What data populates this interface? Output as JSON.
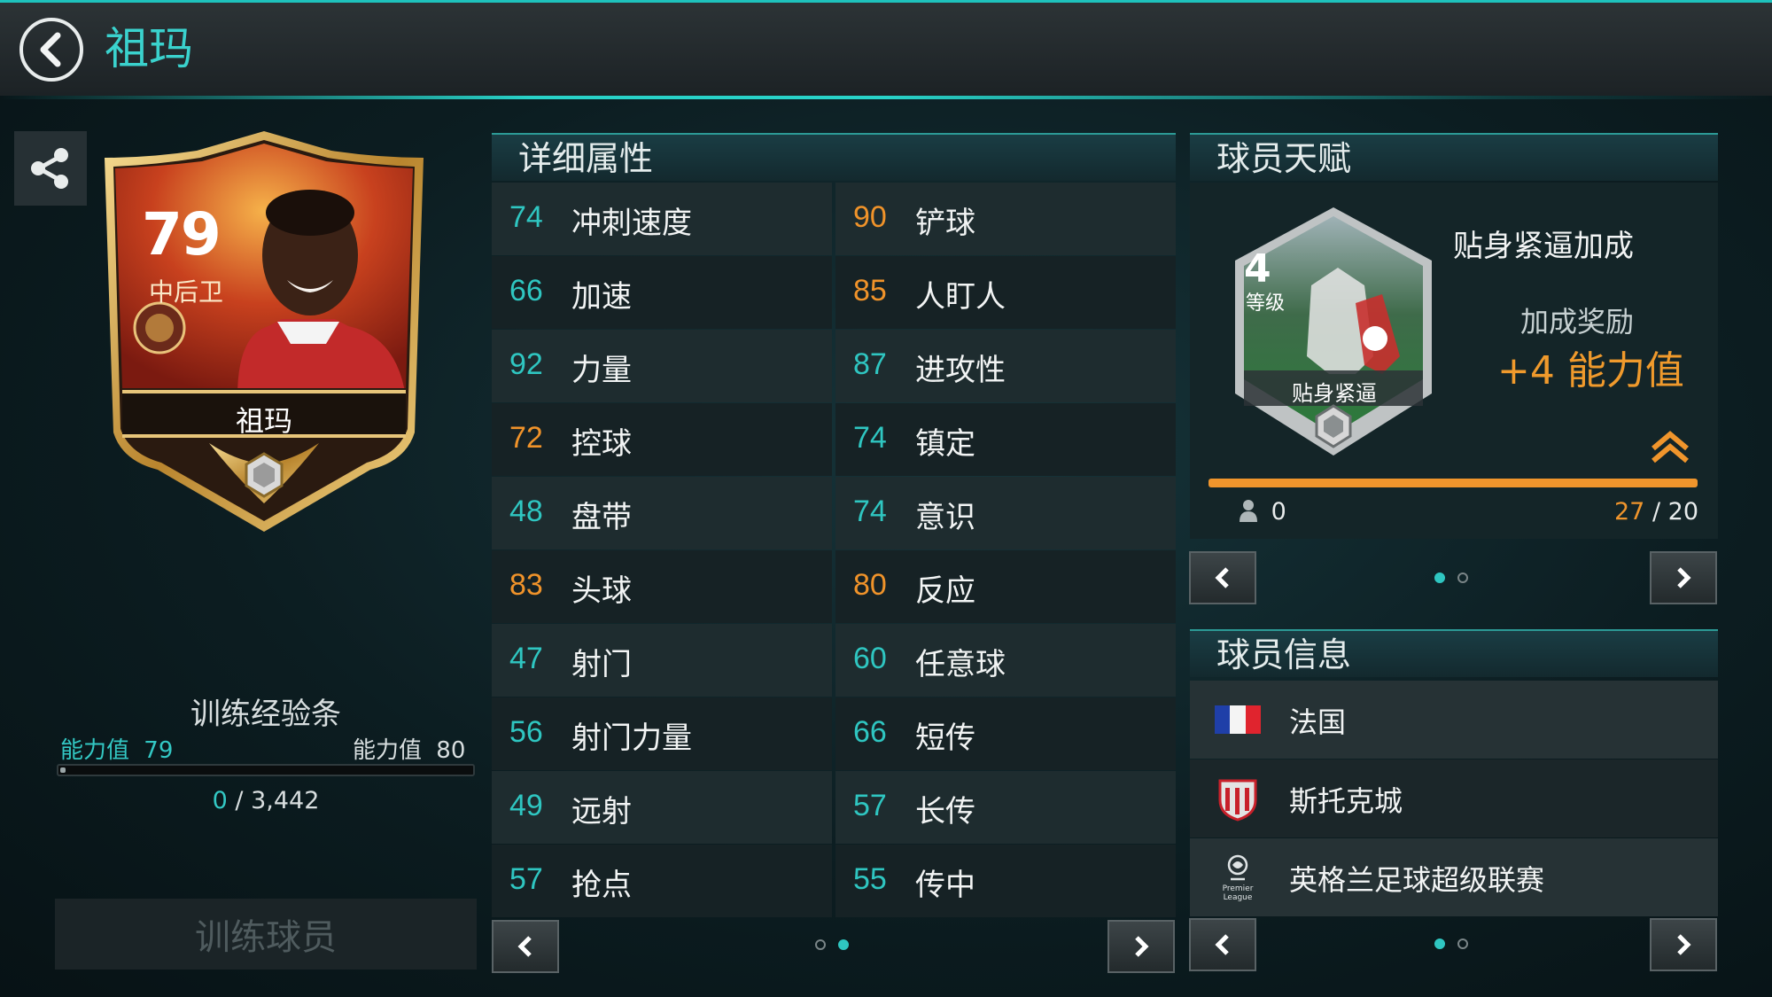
{
  "header": {
    "title": "祖玛"
  },
  "card": {
    "rating": "79",
    "position": "中后卫",
    "name": "祖玛"
  },
  "training": {
    "title": "训练经验条",
    "level_left_label": "能力值",
    "level_left_value": "79",
    "level_right_label": "能力值",
    "level_right_value": "80",
    "xp_current": "0",
    "xp_total": "3,442",
    "xp_progress": 0,
    "button_label": "训练球员"
  },
  "attributes": {
    "title": "详细属性",
    "rows": [
      {
        "left": {
          "value": "74",
          "label": "冲刺速度",
          "color": "teal"
        },
        "right": {
          "value": "90",
          "label": "铲球",
          "color": "orange"
        }
      },
      {
        "left": {
          "value": "66",
          "label": "加速",
          "color": "teal"
        },
        "right": {
          "value": "85",
          "label": "人盯人",
          "color": "orange"
        }
      },
      {
        "left": {
          "value": "92",
          "label": "力量",
          "color": "teal"
        },
        "right": {
          "value": "87",
          "label": "进攻性",
          "color": "teal"
        }
      },
      {
        "left": {
          "value": "72",
          "label": "控球",
          "color": "orange"
        },
        "right": {
          "value": "74",
          "label": "镇定",
          "color": "teal"
        }
      },
      {
        "left": {
          "value": "48",
          "label": "盘带",
          "color": "teal"
        },
        "right": {
          "value": "74",
          "label": "意识",
          "color": "teal"
        }
      },
      {
        "left": {
          "value": "83",
          "label": "头球",
          "color": "orange"
        },
        "right": {
          "value": "80",
          "label": "反应",
          "color": "orange"
        }
      },
      {
        "left": {
          "value": "47",
          "label": "射门",
          "color": "teal"
        },
        "right": {
          "value": "60",
          "label": "任意球",
          "color": "teal"
        }
      },
      {
        "left": {
          "value": "56",
          "label": "射门力量",
          "color": "teal"
        },
        "right": {
          "value": "66",
          "label": "短传",
          "color": "teal"
        }
      },
      {
        "left": {
          "value": "49",
          "label": "远射",
          "color": "teal"
        },
        "right": {
          "value": "57",
          "label": "长传",
          "color": "teal"
        }
      },
      {
        "left": {
          "value": "57",
          "label": "抢点",
          "color": "teal"
        },
        "right": {
          "value": "55",
          "label": "传中",
          "color": "teal"
        }
      }
    ]
  },
  "talent": {
    "title": "球员天赋",
    "level": "4",
    "level_label": "等级",
    "badge_name": "贴身紧逼",
    "name": "贴身紧逼加成",
    "bonus_label": "加成奖励",
    "bonus_value": "+4 能力值",
    "count": "0",
    "progress_current": "27",
    "progress_total": "20",
    "progress_fraction": 1.0
  },
  "info": {
    "title": "球员信息",
    "nation": "法国",
    "club": "斯托克城",
    "league": "英格兰足球超级联赛",
    "league_logo_text_line1": "Premier",
    "league_logo_text_line2": "League"
  },
  "colors": {
    "accent": "#2fc6c1",
    "highlight": "#f0932a"
  }
}
